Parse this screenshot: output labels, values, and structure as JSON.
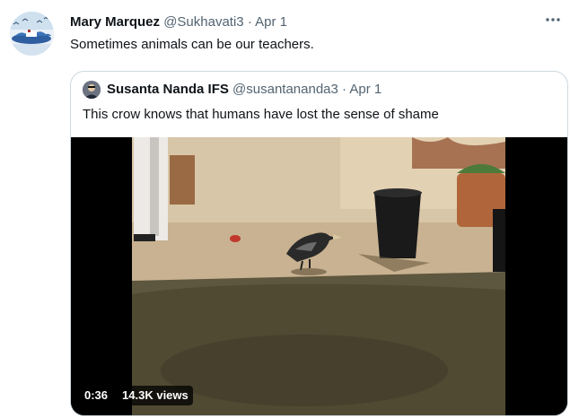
{
  "tweet": {
    "author_name": "Mary Marquez",
    "author_handle": "@Sukhavati3",
    "separator": "·",
    "date": "Apr 1",
    "text": "Sometimes animals can be our teachers.",
    "avatar_icon": "landscape-avatar-icon",
    "more_icon": "more-options-icon"
  },
  "quote": {
    "author_name": "Susanta Nanda IFS",
    "author_handle": "@susantananda3",
    "separator": "·",
    "date": "Apr 1",
    "text": "This crow knows that humans have lost the sense of shame",
    "avatar_icon": "profile-avatar-icon"
  },
  "video": {
    "duration": "0:36",
    "views": "14.3K views",
    "scene": "crow-near-dustbin"
  },
  "colors": {
    "text_primary": "#0f1419",
    "text_secondary": "#536471",
    "border": "#cfd9de"
  }
}
